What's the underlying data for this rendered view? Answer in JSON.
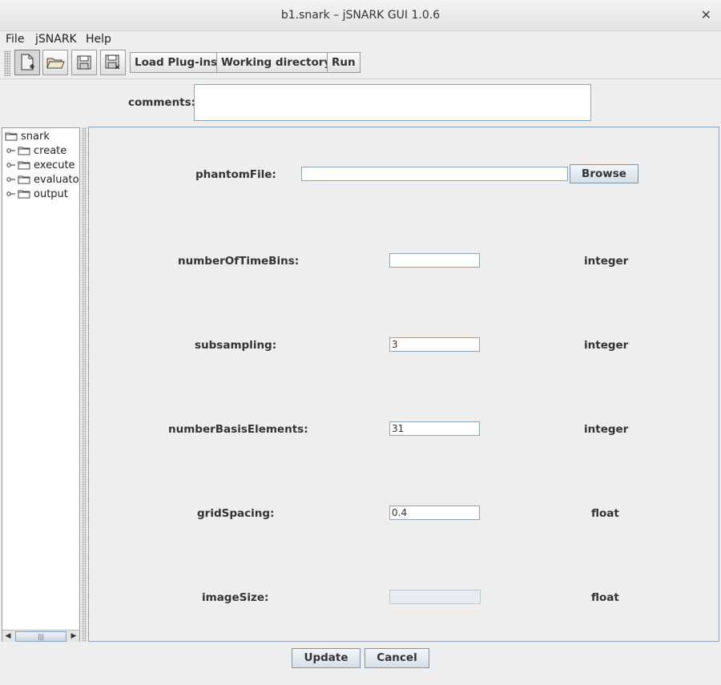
{
  "window": {
    "title": "b1.snark – jSNARK GUI 1.0.6",
    "close_glyph": "✕"
  },
  "menu": {
    "file": "File",
    "jsnark": "jSNARK",
    "help": "Help"
  },
  "toolbar": {
    "icons": [
      "new-document-icon",
      "open-folder-icon",
      "save-icon",
      "save-as-icon"
    ],
    "load_plugins": "Load Plug-ins",
    "working_directory": "Working directory",
    "run": "Run"
  },
  "comments": {
    "label": "comments:",
    "value": ""
  },
  "tree": {
    "root": "snark",
    "children": [
      "create",
      "execute",
      "evaluator",
      "output"
    ]
  },
  "form": {
    "phantomFile": {
      "label": "phantomFile:",
      "value": "",
      "browse": "Browse"
    },
    "fields": [
      {
        "label": "numberOfTimeBins:",
        "value": "",
        "type": "integer",
        "enabled": true
      },
      {
        "label": "subsampling:",
        "value": "3",
        "type": "integer",
        "enabled": true
      },
      {
        "label": "numberBasisElements:",
        "value": "31",
        "type": "integer",
        "enabled": true
      },
      {
        "label": "gridSpacing:",
        "value": "0.4",
        "type": "float",
        "enabled": true
      },
      {
        "label": "imageSize:",
        "value": "",
        "type": "float",
        "enabled": false
      }
    ]
  },
  "buttons": {
    "update": "Update",
    "cancel": "Cancel"
  },
  "colors": {
    "field_border": "#8fa3b7",
    "window_bg": "#eeeeee"
  }
}
